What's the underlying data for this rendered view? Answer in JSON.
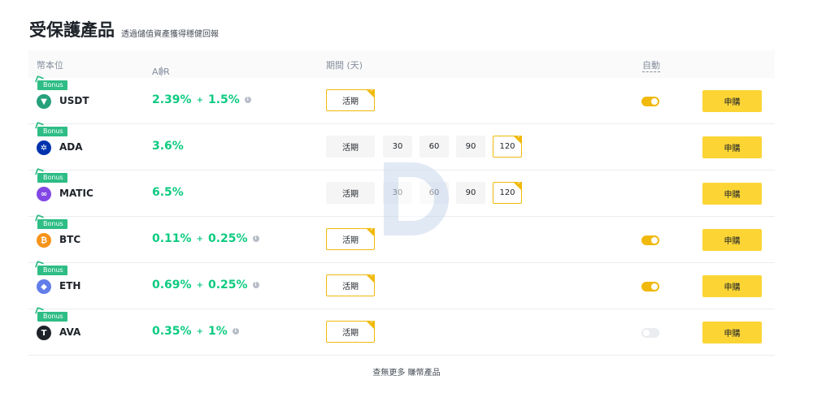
{
  "header": {
    "title": "受保護產品",
    "subtitle": "透過儲值資產獲得穩健回報"
  },
  "table": {
    "columns": {
      "coin": "幣本位",
      "apr": "APR",
      "period": "期間 (天)",
      "auto": "自動"
    }
  },
  "bonus_label": "Bonus",
  "subscribe_label": "申購",
  "rows": [
    {
      "coin": "USDT",
      "icon": "tether-icon",
      "icon_color": "#26a17b",
      "apr_base": "2.39%",
      "apr_bonus": "1.5%",
      "periods": [
        "活期"
      ],
      "selected_period": "活期",
      "auto": true
    },
    {
      "coin": "ADA",
      "icon": "cardano-icon",
      "icon_color": "#0033ad",
      "apr_base": "3.6%",
      "apr_bonus": null,
      "periods": [
        "活期",
        "30",
        "60",
        "90",
        "120"
      ],
      "selected_period": "120",
      "auto": null
    },
    {
      "coin": "MATIC",
      "icon": "polygon-icon",
      "icon_color": "#8247e5",
      "apr_base": "6.5%",
      "apr_bonus": null,
      "periods": [
        "活期",
        "30",
        "60",
        "90",
        "120"
      ],
      "selected_period": "120",
      "auto": null
    },
    {
      "coin": "BTC",
      "icon": "bitcoin-icon",
      "icon_color": "#f7931a",
      "apr_base": "0.11%",
      "apr_bonus": "0.25%",
      "periods": [
        "活期"
      ],
      "selected_period": "活期",
      "auto": true
    },
    {
      "coin": "ETH",
      "icon": "ethereum-icon",
      "icon_color": "#627eea",
      "apr_base": "0.69%",
      "apr_bonus": "0.25%",
      "periods": [
        "活期"
      ],
      "selected_period": "活期",
      "auto": true
    },
    {
      "coin": "AVA",
      "icon": "travala-icon",
      "icon_color": "#1e2329",
      "apr_base": "0.35%",
      "apr_bonus": "1%",
      "periods": [
        "活期"
      ],
      "selected_period": "活期",
      "auto": false
    }
  ],
  "footer": {
    "more_link": "查無更多 賺幣產品"
  },
  "colors": {
    "accent": "#f0b90b",
    "button": "#fcd535",
    "positive": "#0ecb81",
    "bonus": "#2ebd85"
  }
}
